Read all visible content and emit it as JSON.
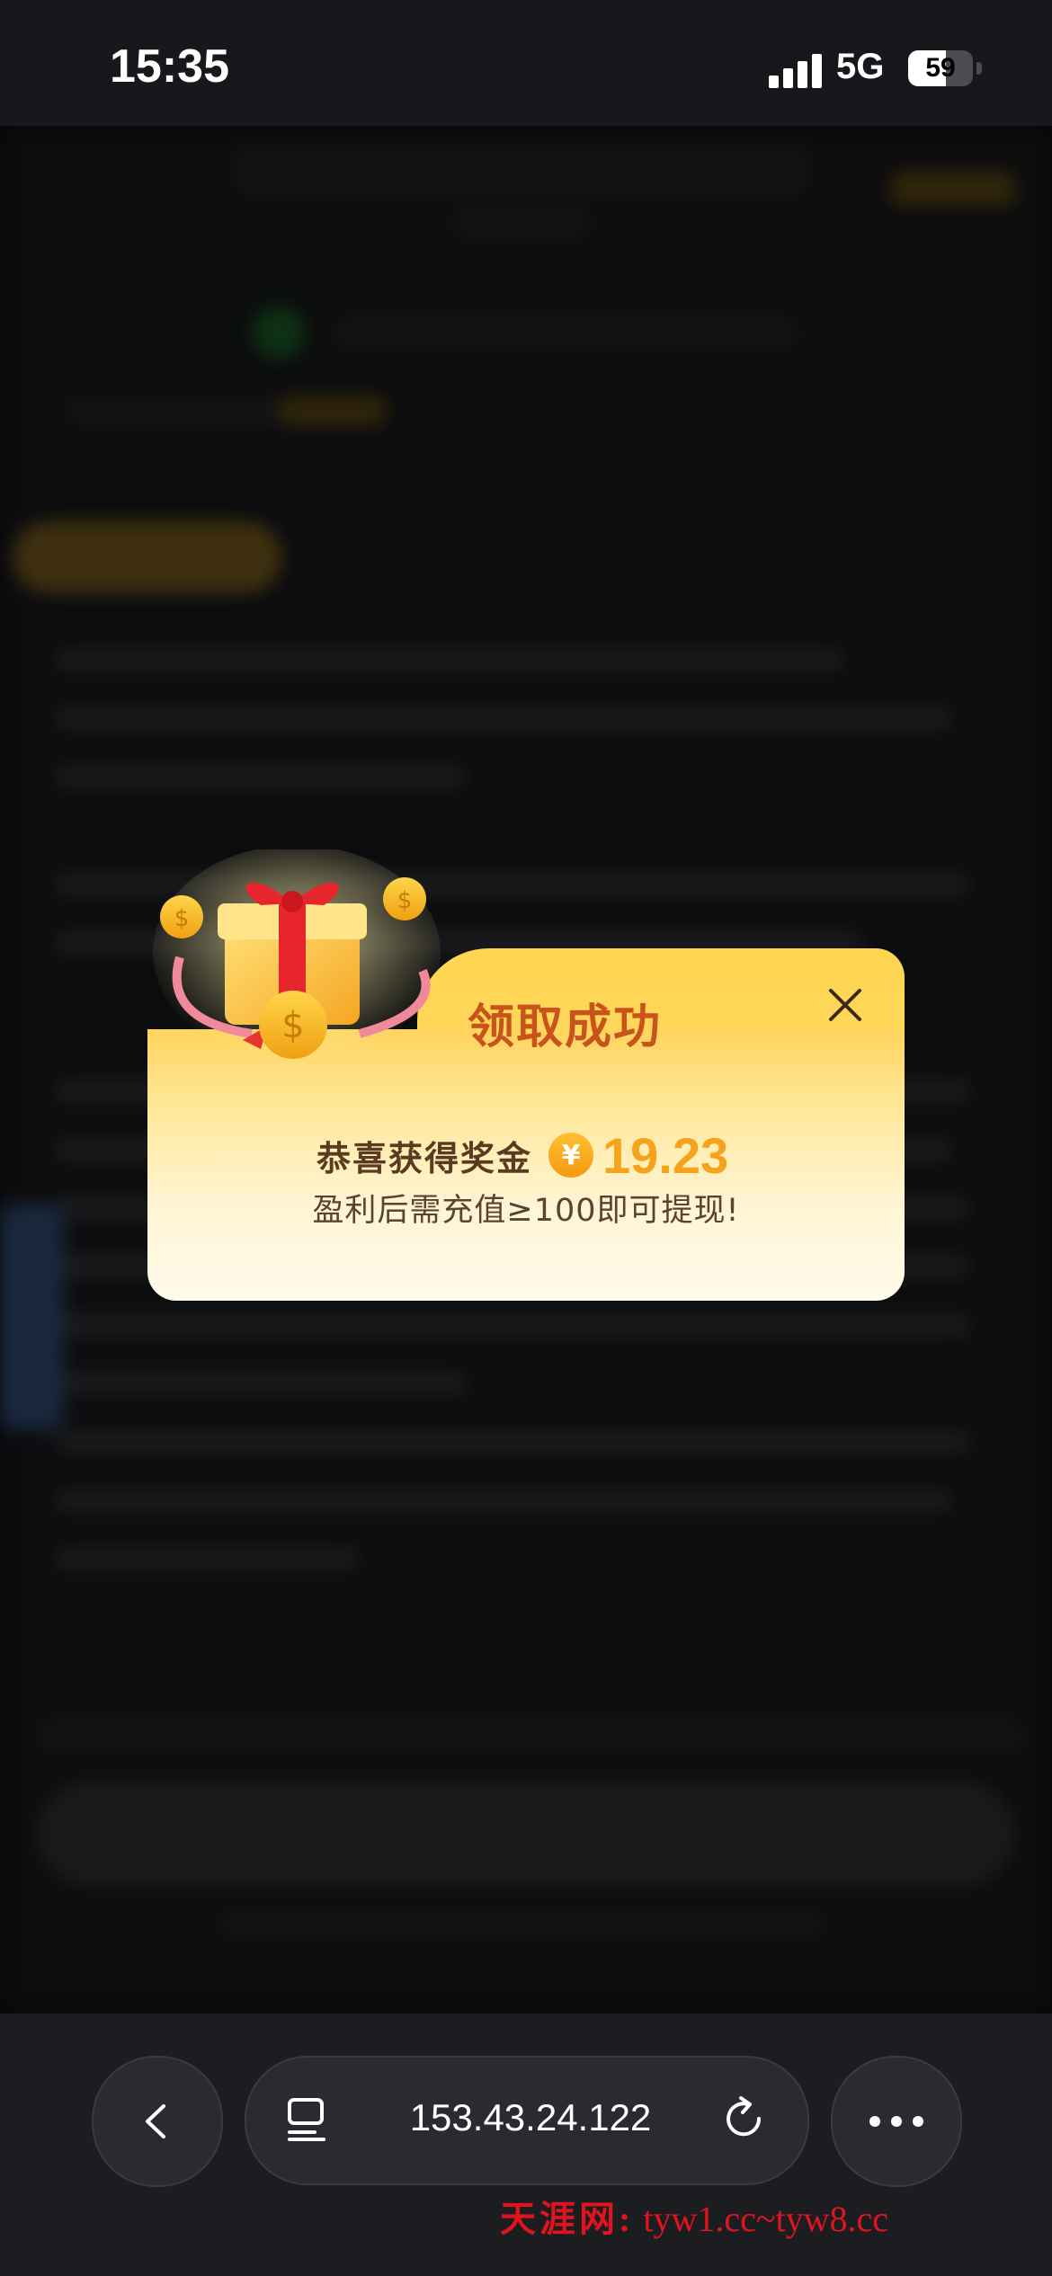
{
  "status_bar": {
    "time": "15:35",
    "network": "5G",
    "battery": "59",
    "battery_level_percent": 59
  },
  "modal": {
    "title": "领取成功",
    "reward_label": "恭喜获得奖金",
    "currency_symbol": "¥",
    "reward_amount": "19.23",
    "note": "盈利后需充值≥100即可提现!"
  },
  "browser": {
    "url": "153.43.24.122"
  },
  "watermark": {
    "site_name": "天涯网:",
    "domains": "tyw1.cc~tyw8.cc"
  },
  "colors": {
    "modal_title": "#c8541b",
    "reward_amount": "#f7a21b",
    "watermark": "#e0141e"
  }
}
